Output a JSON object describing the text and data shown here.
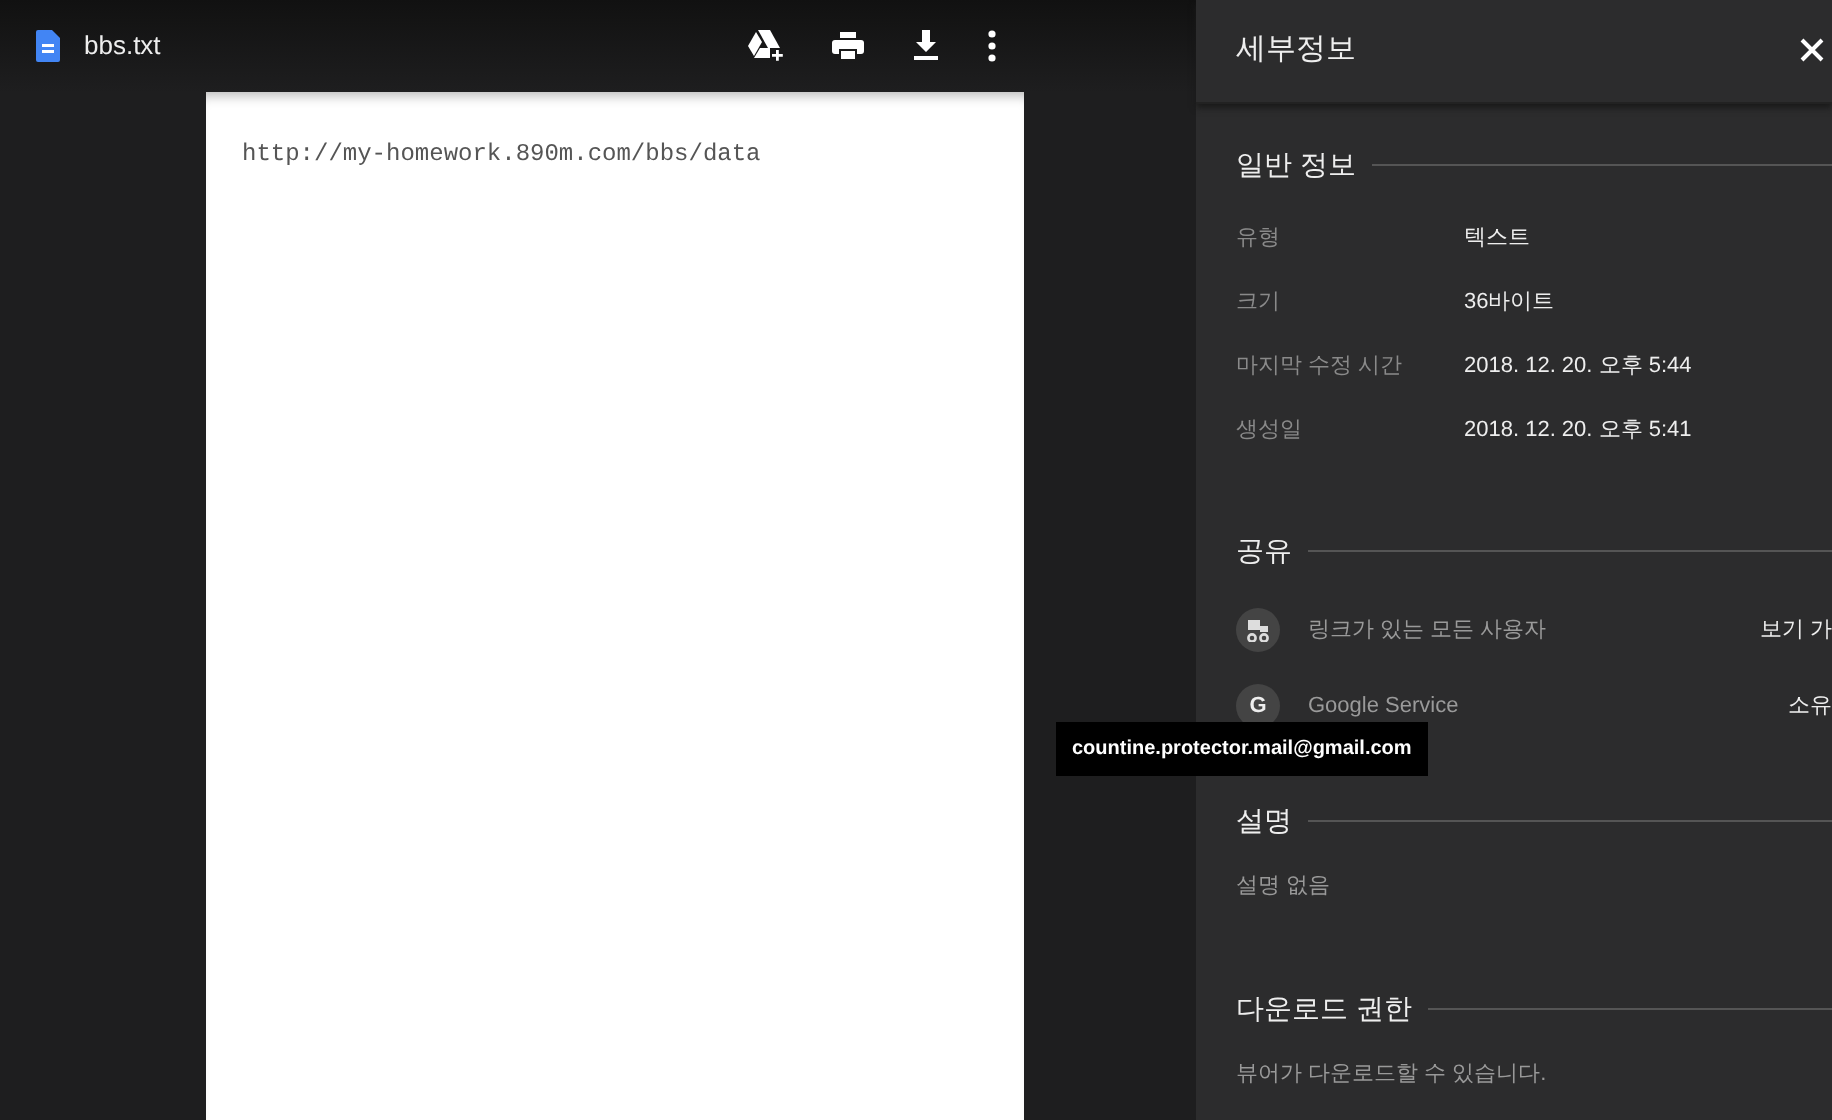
{
  "toolbar": {
    "file_name": "bbs.txt",
    "actions": [
      {
        "kind": "drive-add"
      },
      {
        "kind": "print"
      },
      {
        "kind": "download"
      },
      {
        "kind": "more"
      }
    ]
  },
  "document": {
    "lines": [
      "http://my-homework.890m.com/bbs/data"
    ]
  },
  "details": {
    "title": "세부정보",
    "sections": [
      {
        "kind": "props",
        "heading": "일반 정보",
        "rows": [
          {
            "label": "유형",
            "value": "텍스트"
          },
          {
            "label": "크기",
            "value": "36바이트"
          },
          {
            "label": "마지막 수정 시간",
            "value": "2018. 12. 20. 오후 5:44"
          },
          {
            "label": "생성일",
            "value": "2018. 12. 20. 오후 5:41"
          }
        ]
      },
      {
        "kind": "sharing",
        "heading": "공유",
        "people": [
          {
            "kind": "link",
            "name": "링크가 있는 모든 사용자",
            "role": "보기 가"
          },
          {
            "kind": "letter",
            "letter": "G",
            "name": "Google Service",
            "role": "소유",
            "tooltip": "countine.protector.mail@gmail.com"
          }
        ]
      },
      {
        "kind": "text",
        "heading": "설명",
        "text": "설명 없음"
      },
      {
        "kind": "text",
        "heading": "다운로드 권한",
        "text": "뷰어가 다운로드할 수 있습니다."
      }
    ]
  }
}
